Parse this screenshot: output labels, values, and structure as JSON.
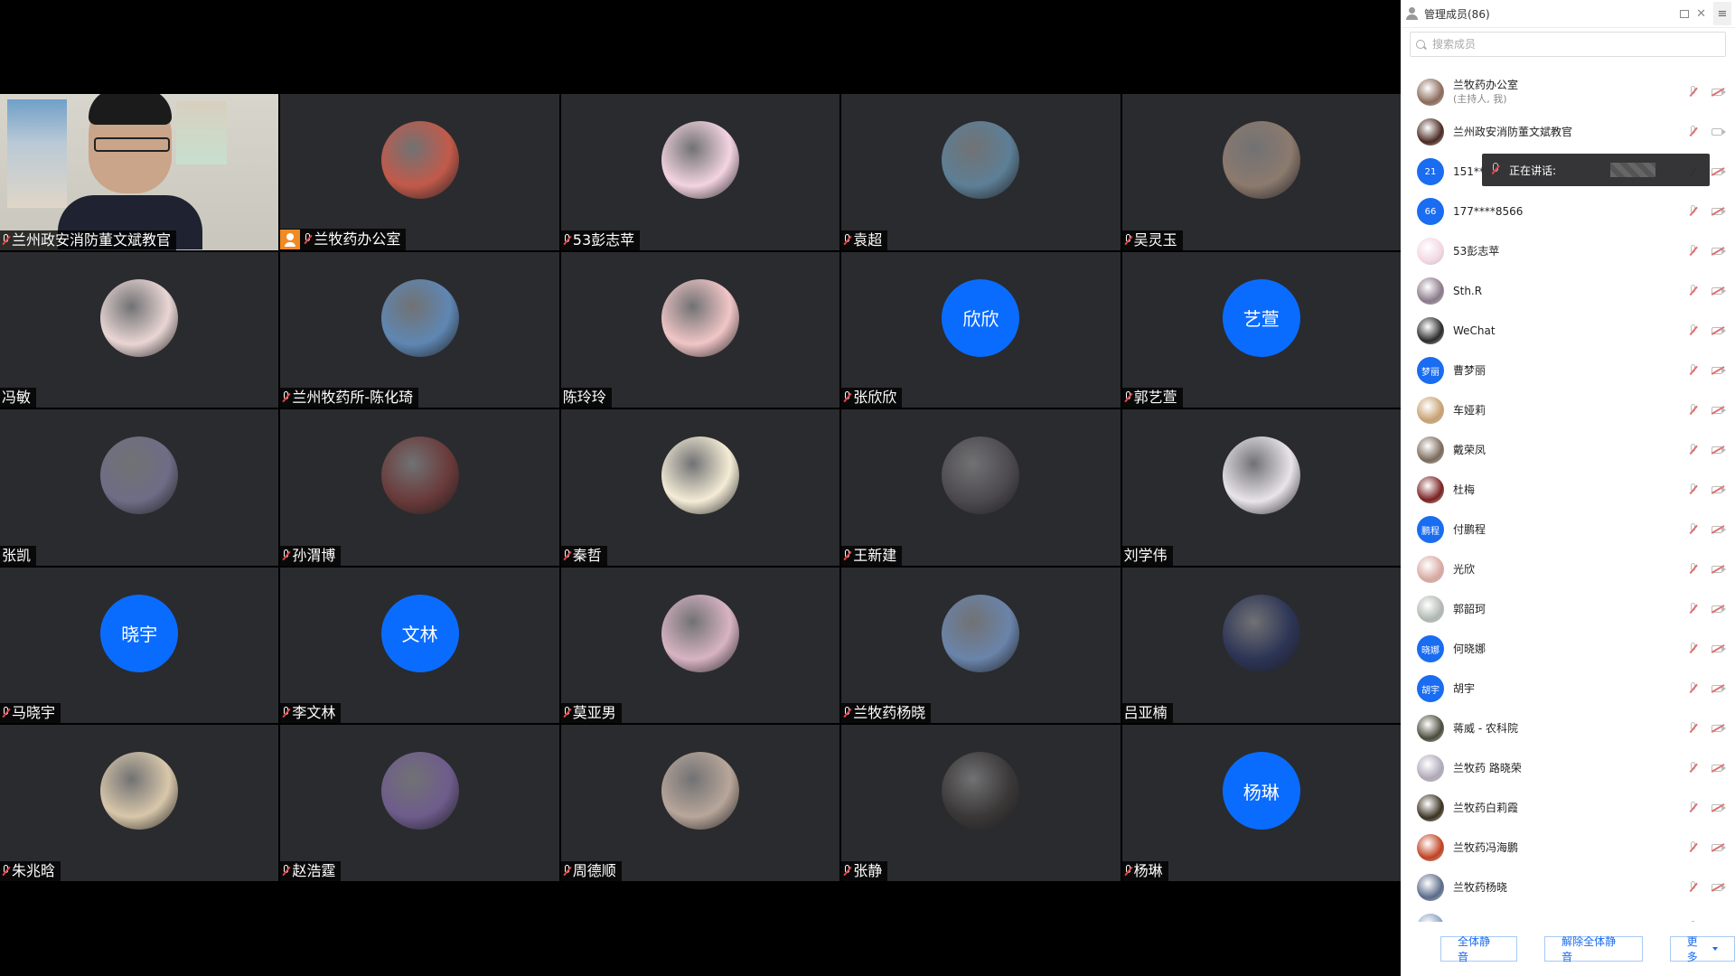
{
  "panel": {
    "title": "管理成员(86)",
    "search_placeholder": "搜索成员",
    "menu_glyph": "≡",
    "close_glyph": "✕",
    "speaking_label": "正在讲话:",
    "footer": {
      "mute_all": "全体静音",
      "unmute_all": "解除全体静音",
      "more": "更多"
    }
  },
  "members": [
    {
      "name": "兰牧药办公室",
      "sub": "(主持人, 我)",
      "avatar_text": "",
      "color": "#8a6a5a",
      "cam": "off"
    },
    {
      "name": "兰州政安消防董文斌教官",
      "sub": "",
      "avatar_text": "",
      "color": "#4a2a22",
      "cam": "on"
    },
    {
      "name": "151**",
      "sub": "",
      "avatar_text": "21",
      "color": "#1a6cf0",
      "cam": "off"
    },
    {
      "name": "177****8566",
      "sub": "",
      "avatar_text": "66",
      "color": "#1a6cf0",
      "cam": "off"
    },
    {
      "name": "53彭志苹",
      "sub": "",
      "avatar_text": "",
      "color": "#f2d7e2",
      "cam": "off"
    },
    {
      "name": "Sth.R",
      "sub": "",
      "avatar_text": "",
      "color": "#8a7a8a",
      "cam": "off"
    },
    {
      "name": "WeChat",
      "sub": "",
      "avatar_text": "",
      "color": "#2a2a2a",
      "cam": "off"
    },
    {
      "name": "曹梦丽",
      "sub": "",
      "avatar_text": "梦丽",
      "color": "#1a6cf0",
      "cam": "off"
    },
    {
      "name": "车娅莉",
      "sub": "",
      "avatar_text": "",
      "color": "#c8a070",
      "cam": "off"
    },
    {
      "name": "戴荣凤",
      "sub": "",
      "avatar_text": "",
      "color": "#7a6a5a",
      "cam": "off"
    },
    {
      "name": "杜梅",
      "sub": "",
      "avatar_text": "",
      "color": "#7a2020",
      "cam": "off"
    },
    {
      "name": "付鹏程",
      "sub": "",
      "avatar_text": "鹏程",
      "color": "#1a6cf0",
      "cam": "off"
    },
    {
      "name": "光欣",
      "sub": "",
      "avatar_text": "",
      "color": "#d8a8a0",
      "cam": "off"
    },
    {
      "name": "郭韶珂",
      "sub": "",
      "avatar_text": "",
      "color": "#b0b8b0",
      "cam": "off"
    },
    {
      "name": "何晓娜",
      "sub": "",
      "avatar_text": "晓娜",
      "color": "#1a6cf0",
      "cam": "off"
    },
    {
      "name": "胡宇",
      "sub": "",
      "avatar_text": "胡宇",
      "color": "#1a6cf0",
      "cam": "off"
    },
    {
      "name": "蒋威 - 农科院",
      "sub": "",
      "avatar_text": "",
      "color": "#4a4a3a",
      "cam": "off"
    },
    {
      "name": "兰牧药 路晓荣",
      "sub": "",
      "avatar_text": "",
      "color": "#b0a8b8",
      "cam": "off"
    },
    {
      "name": "兰牧药白莉霞",
      "sub": "",
      "avatar_text": "",
      "color": "#3a3020",
      "cam": "off"
    },
    {
      "name": "兰牧药冯海鹏",
      "sub": "",
      "avatar_text": "",
      "color": "#c04020",
      "cam": "off"
    },
    {
      "name": "兰牧药杨晓",
      "sub": "",
      "avatar_text": "",
      "color": "#5a6a8a",
      "cam": "off"
    },
    {
      "name": "",
      "sub": "",
      "avatar_text": "",
      "color": "#8aa0c0",
      "cam": "off"
    }
  ],
  "tiles": [
    {
      "name": "兰州政安消防董文斌教官",
      "type": "camera",
      "host": false,
      "color": "#0a6cff",
      "avatar_text": ""
    },
    {
      "name": "兰牧药办公室",
      "type": "image",
      "host": true,
      "color": "#c25a4a",
      "avatar_text": ""
    },
    {
      "name": "53彭志苹",
      "type": "image",
      "host": false,
      "color": "#f3d4e0",
      "avatar_text": ""
    },
    {
      "name": "袁超",
      "type": "image",
      "host": false,
      "color": "#5d7f96",
      "avatar_text": ""
    },
    {
      "name": "吴灵玉",
      "type": "image",
      "host": false,
      "color": "#8c7a6e",
      "avatar_text": ""
    },
    {
      "name": "冯敏",
      "type": "image",
      "host": false,
      "color": "#e9d6d4",
      "avatar_text": "",
      "nomic": true
    },
    {
      "name": "兰州牧药所-陈化琦",
      "type": "image",
      "host": false,
      "color": "#5f87b3",
      "avatar_text": ""
    },
    {
      "name": "陈玲玲",
      "type": "image",
      "host": false,
      "color": "#f1c6c7",
      "avatar_text": "",
      "nomic": true
    },
    {
      "name": "张欣欣",
      "type": "text",
      "host": false,
      "color": "#0a6cff",
      "avatar_text": "欣欣"
    },
    {
      "name": "郭艺萱",
      "type": "text",
      "host": false,
      "color": "#0a6cff",
      "avatar_text": "艺萱"
    },
    {
      "name": "张凯",
      "type": "image",
      "host": false,
      "color": "#6e6d86",
      "avatar_text": "",
      "nomic": true
    },
    {
      "name": "孙渭博",
      "type": "image",
      "host": false,
      "color": "#6a3a3a",
      "avatar_text": ""
    },
    {
      "name": "秦哲",
      "type": "image",
      "host": false,
      "color": "#f4ecd6",
      "avatar_text": ""
    },
    {
      "name": "王新建",
      "type": "image",
      "host": false,
      "color": "#4d4a4f",
      "avatar_text": ""
    },
    {
      "name": "刘学伟",
      "type": "image",
      "host": false,
      "color": "#e8e4ea",
      "avatar_text": "",
      "nomic": true
    },
    {
      "name": "马晓宇",
      "type": "text",
      "host": false,
      "color": "#0a6cff",
      "avatar_text": "晓宇"
    },
    {
      "name": "李文林",
      "type": "text",
      "host": false,
      "color": "#0a6cff",
      "avatar_text": "文林"
    },
    {
      "name": "莫亚男",
      "type": "image",
      "host": false,
      "color": "#d8b4c2",
      "avatar_text": ""
    },
    {
      "name": "兰牧药杨晓",
      "type": "image",
      "host": false,
      "color": "#6a84aa",
      "avatar_text": ""
    },
    {
      "name": "吕亚楠",
      "type": "image",
      "host": false,
      "color": "#2d3556",
      "avatar_text": "",
      "nomic": true
    },
    {
      "name": "朱兆晗",
      "type": "image",
      "host": false,
      "color": "#d8c7aa",
      "avatar_text": ""
    },
    {
      "name": "赵浩霆",
      "type": "image",
      "host": false,
      "color": "#6e5c8c",
      "avatar_text": ""
    },
    {
      "name": "周德顺",
      "type": "image",
      "host": false,
      "color": "#b8a69a",
      "avatar_text": ""
    },
    {
      "name": "张静",
      "type": "image",
      "host": false,
      "color": "#3b3838",
      "avatar_text": ""
    },
    {
      "name": "杨琳",
      "type": "text",
      "host": false,
      "color": "#0a6cff",
      "avatar_text": "杨琳"
    }
  ]
}
